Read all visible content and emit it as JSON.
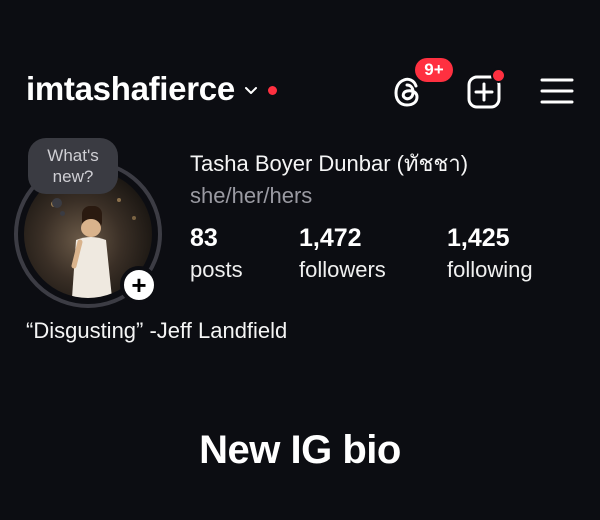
{
  "header": {
    "username": "imtashafierce",
    "threads_badge": "9+",
    "icons": {
      "chevron": "chevron-down-icon",
      "threads": "threads-icon",
      "create": "create-post-icon",
      "menu": "hamburger-menu-icon"
    },
    "accent_color": "#ff3040"
  },
  "profile": {
    "note_prompt_line1": "What's",
    "note_prompt_line2": "new?",
    "add_story_label": "+",
    "display_name": "Tasha Boyer Dunbar (ทัชชา)",
    "pronouns": "she/her/hers",
    "stats": [
      {
        "value": "83",
        "label": "posts"
      },
      {
        "value": "1,472",
        "label": "followers"
      },
      {
        "value": "1,425",
        "label": "following"
      }
    ],
    "bio": "“Disgusting” -Jeff Landfield"
  },
  "caption": "New IG bio"
}
